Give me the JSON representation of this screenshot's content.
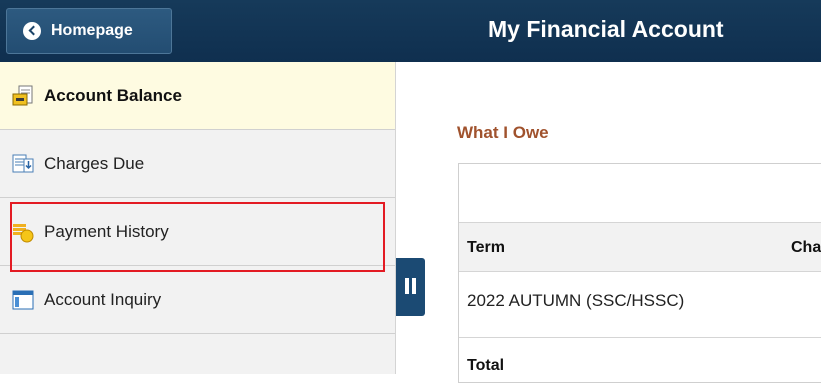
{
  "header": {
    "home_label": "Homepage",
    "title": "My Financial Account"
  },
  "sidebar": {
    "items": [
      {
        "label": "Account Balance",
        "icon": "account-balance-icon",
        "active": true
      },
      {
        "label": "Charges Due",
        "icon": "charges-due-icon",
        "active": false
      },
      {
        "label": "Payment History",
        "icon": "payment-history-icon",
        "active": false
      },
      {
        "label": "Account Inquiry",
        "icon": "account-inquiry-icon",
        "active": false
      }
    ]
  },
  "main": {
    "section_title": "What I Owe",
    "table": {
      "columns": [
        "Term",
        "Cha"
      ],
      "rows": [
        [
          "2022 AUTUMN (SSC/HSSC)"
        ]
      ],
      "total_label": "Total"
    }
  },
  "colors": {
    "header_bg": "#163a5a",
    "active_item_bg": "#fefbe1",
    "section_title": "#a0522d",
    "highlight": "#e31b23"
  }
}
